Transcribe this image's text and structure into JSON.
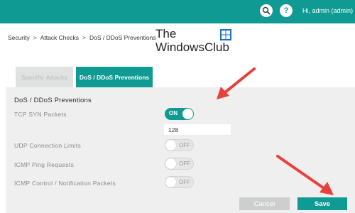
{
  "header": {
    "help_label": "?",
    "user_label": "Hi, admin (admin)"
  },
  "breadcrumb": {
    "items": [
      "Security",
      "Attack Checks",
      "DoS / DDoS Preventions"
    ],
    "separator": ">"
  },
  "watermark": {
    "line1": "The",
    "line2": "WindowsClub"
  },
  "tabs": [
    {
      "label": "Specific Attacks",
      "active": false
    },
    {
      "label": "DoS / DDoS Preventions",
      "active": true
    }
  ],
  "panel": {
    "title": "DoS / DDoS Preventions",
    "rows": [
      {
        "label": "TCP SYN Packets",
        "state": "ON"
      },
      {
        "label": "UDP Connection Limits",
        "state": "OFF"
      },
      {
        "label": "ICMP Ping Requests",
        "state": "OFF"
      },
      {
        "label": "ICMP Control / Notification Packets",
        "state": "OFF"
      }
    ],
    "tcp_syn_value": "128"
  },
  "actions": {
    "cancel_label": "Cancel",
    "save_label": "Save"
  },
  "colors": {
    "accent": "#0f9a93",
    "annotation_arrow": "#e8403a"
  }
}
